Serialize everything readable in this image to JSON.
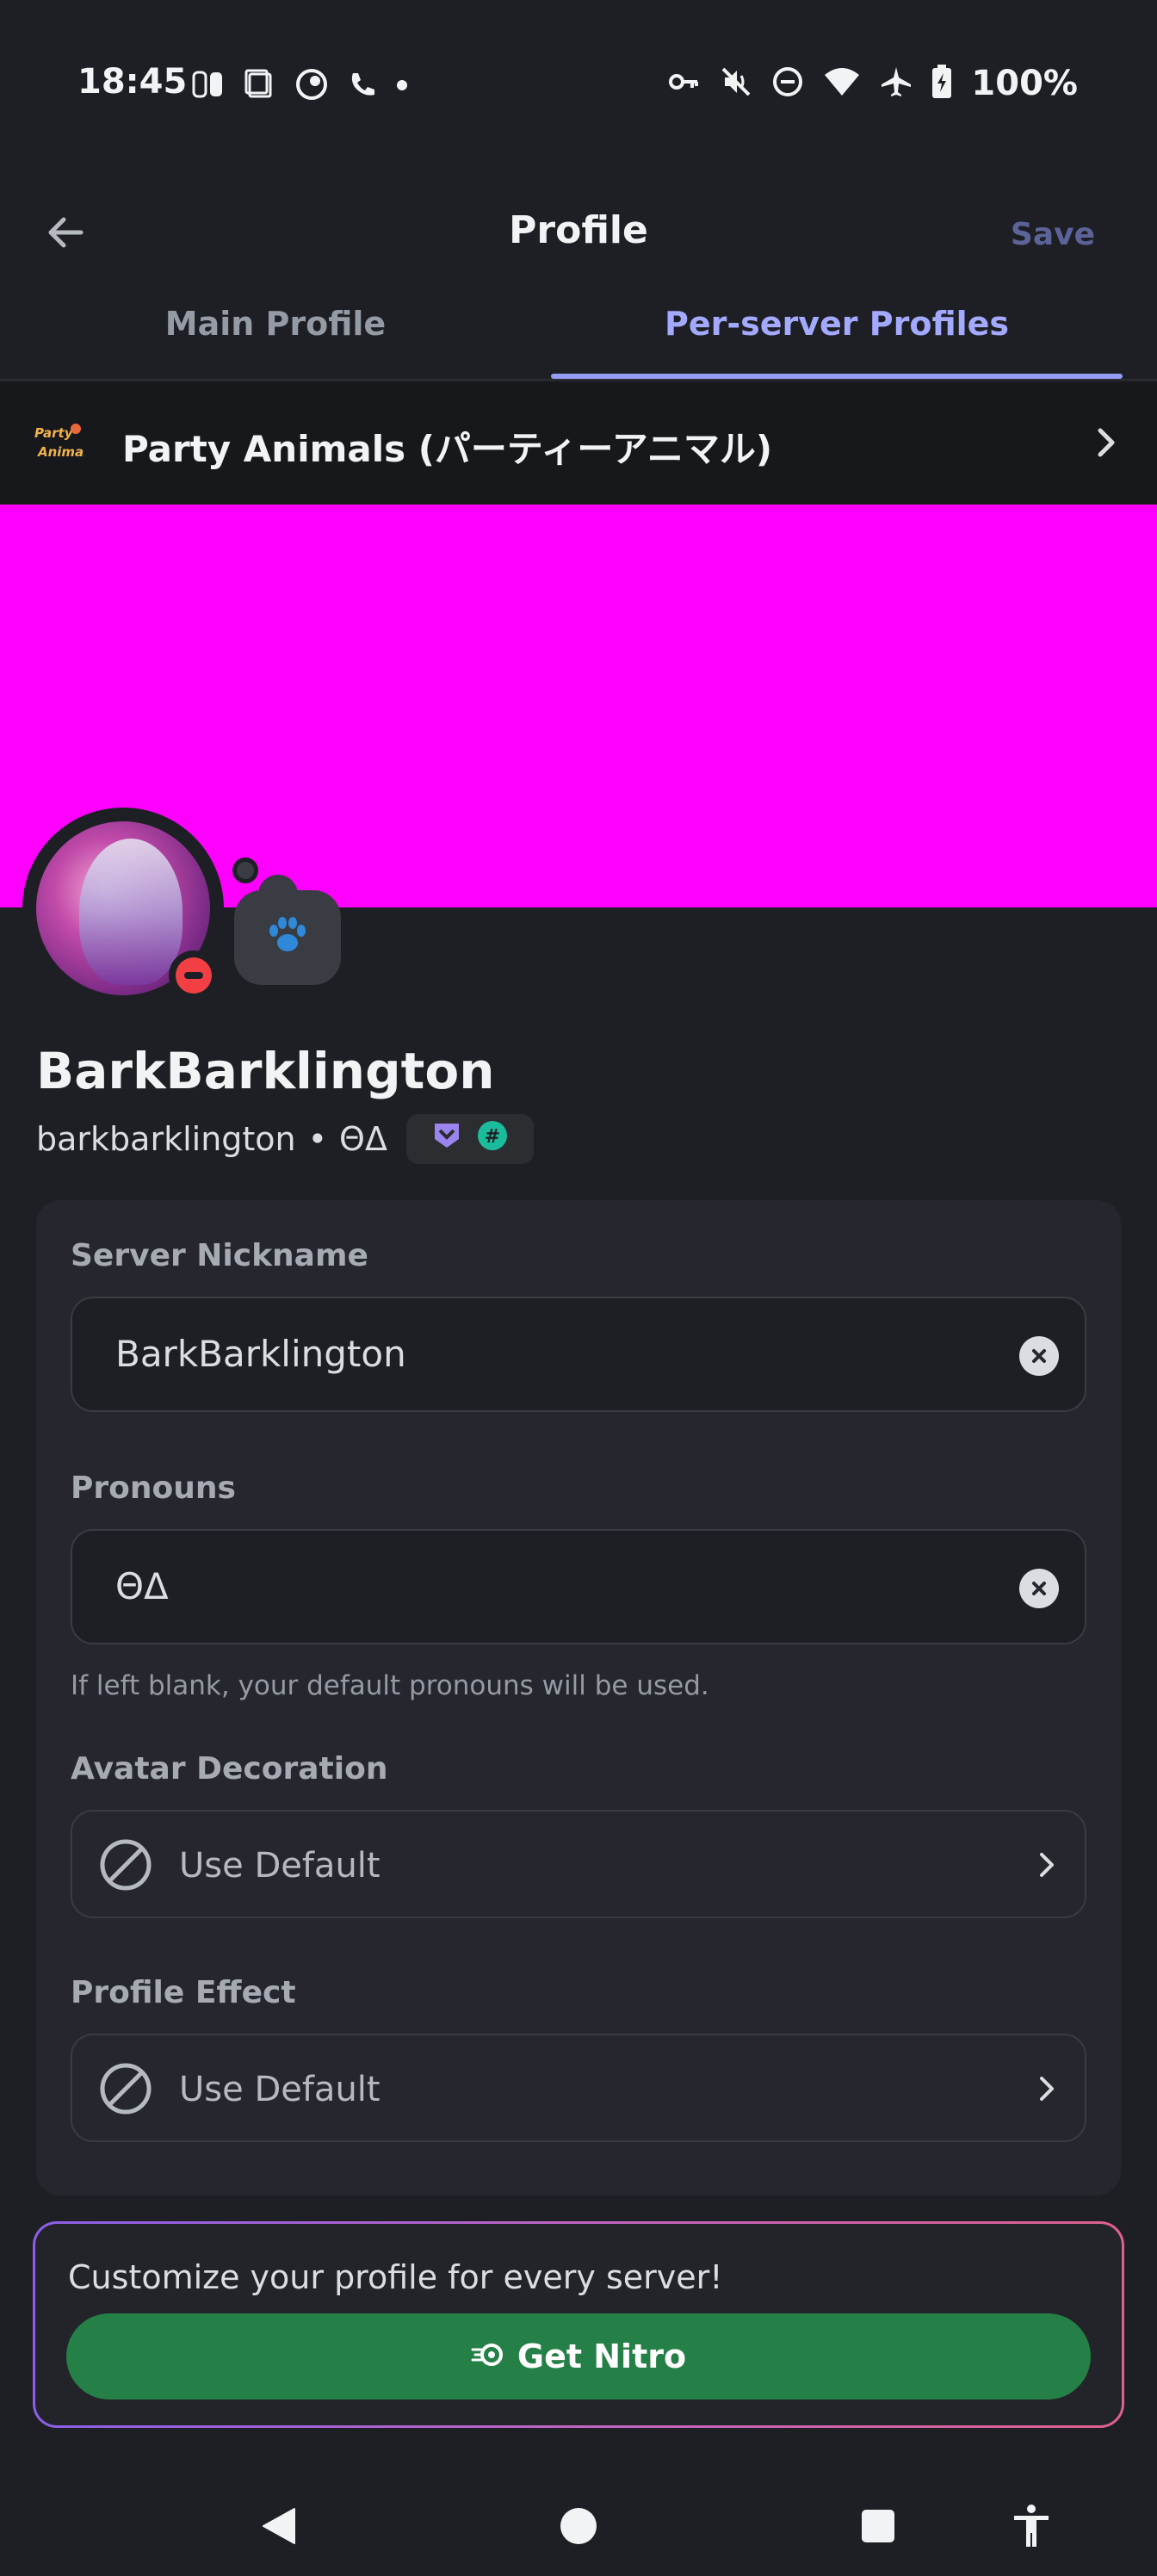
{
  "status_bar": {
    "time": "18:45",
    "battery_pct": "100%",
    "left_icons": [
      "switch-icon",
      "tablet-icon",
      "app-icon",
      "call-icon",
      "dot-icon"
    ],
    "right_icons": [
      "key-icon",
      "mute-icon",
      "dnd-icon",
      "wifi-icon",
      "airplane-icon",
      "battery-icon"
    ]
  },
  "header": {
    "title": "Profile",
    "save_label": "Save"
  },
  "tabs": [
    {
      "label": "Main Profile",
      "active": false
    },
    {
      "label": "Per-server Profiles",
      "active": true
    }
  ],
  "server": {
    "logo_text": "Party Animals",
    "name": "Party Animals (パーティーアニマル)"
  },
  "colors": {
    "banner": "#ff00ff",
    "accent": "#949cf7",
    "nitro_button": "#248046",
    "dnd_status": "#f23f43"
  },
  "profile": {
    "display_name": "BarkBarklington",
    "username": "barkbarklington",
    "separator": "•",
    "pronouns": "ΘΔ",
    "status": "do-not-disturb",
    "bubble_emoji": "🐾"
  },
  "form": {
    "nickname_label": "Server Nickname",
    "nickname_value": "BarkBarklington",
    "pronouns_label": "Pronouns",
    "pronouns_value": "ΘΔ",
    "pronouns_helper": "If left blank, your default pronouns will be used.",
    "decoration_label": "Avatar Decoration",
    "decoration_value": "Use Default",
    "effect_label": "Profile Effect",
    "effect_value": "Use Default"
  },
  "promo": {
    "text": "Customize your profile for every server!",
    "button_label": "Get Nitro"
  },
  "nav": [
    "back-icon",
    "home-icon",
    "recents-icon",
    "accessibility-icon"
  ]
}
